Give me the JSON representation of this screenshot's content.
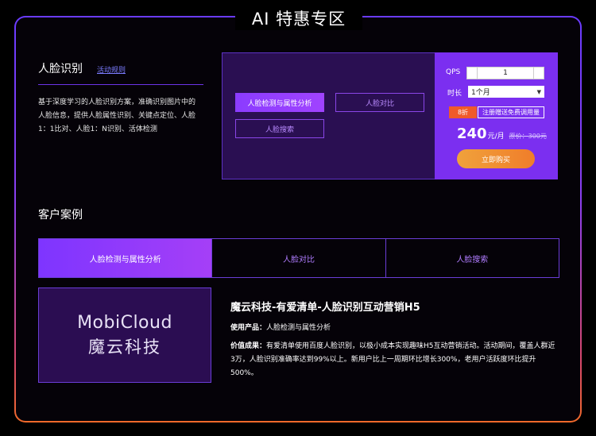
{
  "title": "AI 特惠专区",
  "left": {
    "title": "人脸识别",
    "rules_link": "活动规则",
    "description": "基于深度学习的人脸识别方案，准确识别图片中的人脸信息，提供人脸属性识别、关键点定位、人脸1：1比对、人脸1：N识别、活体检测"
  },
  "products": {
    "options": [
      "人脸检测与属性分析",
      "人脸对比",
      "人脸搜索"
    ]
  },
  "pricing": {
    "qps_label": "QPS",
    "qps_value": "1",
    "duration_label": "时长",
    "duration_value": "1个月",
    "discount_badge": "8折",
    "promo_text": "注册赠送免费调用量",
    "price": "240",
    "price_unit": "元/月",
    "original_price": "原价：300元",
    "buy_button": "立即购买"
  },
  "cases": {
    "title": "客户案例",
    "tabs": [
      "人脸检测与属性分析",
      "人脸对比",
      "人脸搜索"
    ],
    "logo_en": "MobiCloud",
    "logo_cn": "魔云科技",
    "case_title": "魔云科技-有爱清单-人脸识别互动营销H5",
    "product_label": "使用产品：",
    "product_value": "人脸检测与属性分析",
    "value_label": "价值成果：",
    "value_text": "有爱清单使用百度人脸识别，以极小成本实现趣味H5互动营销活动。活动期间，覆盖人群近3万，人脸识别准确率达到99%以上。新用户比上一周期环比增长300%，老用户活跃度环比提升500%。"
  },
  "colors": {
    "accent_purple": "#7b2ff0",
    "orange": "#f05a2a",
    "link": "#7b7cff"
  }
}
